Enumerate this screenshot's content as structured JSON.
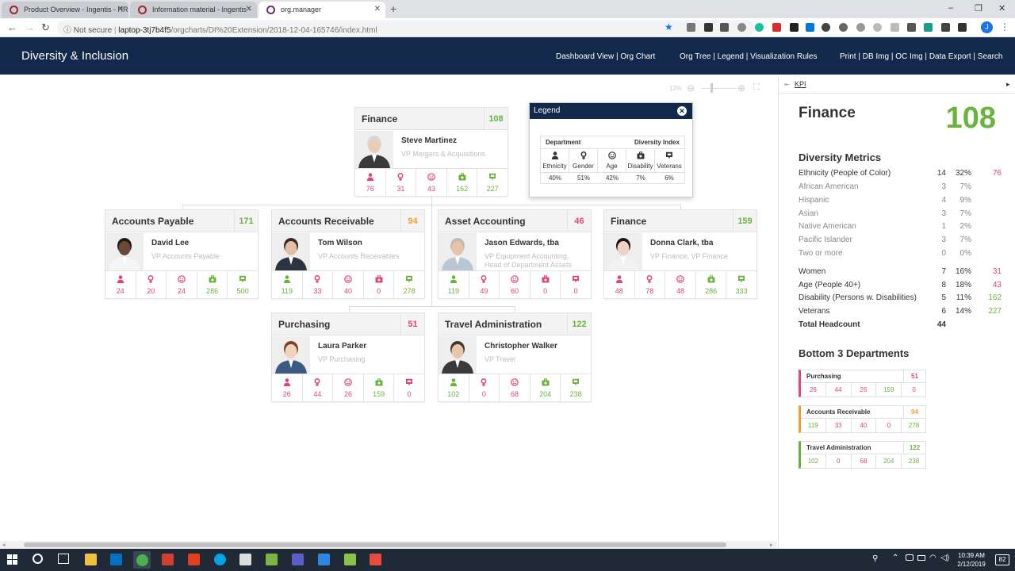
{
  "browser": {
    "tabs": [
      {
        "title": "Product Overview - Ingentis - HR"
      },
      {
        "title": "Information material - Ingentis - "
      },
      {
        "title": "org.manager"
      }
    ],
    "window_controls": [
      "–",
      "❐",
      "✕"
    ],
    "security": "Not secure",
    "url_host": "laptop-3tj7b4f5",
    "url_path": "/orgcharts/DI%20Extension/2018-12-04-165746/index.html",
    "avatar": "J"
  },
  "header": {
    "title": "Diversity & Inclusion",
    "nav1": "Dashboard View | Org Chart",
    "nav2": "Org Tree | Legend | Visualization Rules",
    "nav3": "Print | DB Img | OC Img | Data Export | Search"
  },
  "zoom": {
    "level": "12%"
  },
  "metric_icons": [
    "person-icon",
    "gender-icon",
    "age-icon",
    "disability-icon",
    "veterans-icon"
  ],
  "cards": [
    {
      "id": "finance-root",
      "name": "Finance",
      "count": "108",
      "count_color": "#6ab43e",
      "person": "Steve Martinez",
      "role": "VP Mergers & Acquisitions",
      "metrics": [
        {
          "v": "76",
          "c": "pink"
        },
        {
          "v": "31",
          "c": "pink"
        },
        {
          "v": "43",
          "c": "pink"
        },
        {
          "v": "162",
          "c": "green"
        },
        {
          "v": "227",
          "c": "green"
        }
      ]
    },
    {
      "id": "accounts-payable",
      "name": "Accounts Payable",
      "count": "171",
      "count_color": "#6ab43e",
      "person": "David Lee",
      "role": "VP Accounts Payable",
      "metrics": [
        {
          "v": "24",
          "c": "pink"
        },
        {
          "v": "20",
          "c": "pink"
        },
        {
          "v": "24",
          "c": "pink"
        },
        {
          "v": "286",
          "c": "green"
        },
        {
          "v": "500",
          "c": "green"
        }
      ]
    },
    {
      "id": "accounts-receivable",
      "name": "Accounts Receivable",
      "count": "94",
      "count_color": "#f0a030",
      "person": "Tom Wilson",
      "role": "VP Accounts Receivables",
      "metrics": [
        {
          "v": "119",
          "c": "green"
        },
        {
          "v": "33",
          "c": "pink"
        },
        {
          "v": "40",
          "c": "pink"
        },
        {
          "v": "0",
          "c": "pink"
        },
        {
          "v": "278",
          "c": "green"
        }
      ]
    },
    {
      "id": "asset-accounting",
      "name": "Asset Accounting",
      "count": "46",
      "count_color": "#e0447a",
      "person": "Jason Edwards, tba",
      "role": "VP Equipment Accounting, Head of Department Assets",
      "metrics": [
        {
          "v": "119",
          "c": "green"
        },
        {
          "v": "49",
          "c": "pink"
        },
        {
          "v": "60",
          "c": "pink"
        },
        {
          "v": "0",
          "c": "pink"
        },
        {
          "v": "0",
          "c": "pink"
        }
      ]
    },
    {
      "id": "finance-sub",
      "name": "Finance",
      "count": "159",
      "count_color": "#6ab43e",
      "person": "Donna Clark, tba",
      "role": "VP Finance, VP Finance",
      "metrics": [
        {
          "v": "48",
          "c": "pink"
        },
        {
          "v": "78",
          "c": "pink"
        },
        {
          "v": "48",
          "c": "pink"
        },
        {
          "v": "286",
          "c": "green"
        },
        {
          "v": "333",
          "c": "green"
        }
      ]
    },
    {
      "id": "purchasing",
      "name": "Purchasing",
      "count": "51",
      "count_color": "#e0447a",
      "person": "Laura Parker",
      "role": "VP Purchasing",
      "metrics": [
        {
          "v": "26",
          "c": "pink"
        },
        {
          "v": "44",
          "c": "pink"
        },
        {
          "v": "26",
          "c": "pink"
        },
        {
          "v": "159",
          "c": "green"
        },
        {
          "v": "0",
          "c": "pink"
        }
      ]
    },
    {
      "id": "travel-administration",
      "name": "Travel Administration",
      "count": "122",
      "count_color": "#6ab43e",
      "person": "Christopher Walker",
      "role": "VP Travel",
      "metrics": [
        {
          "v": "102",
          "c": "green"
        },
        {
          "v": "0",
          "c": "pink"
        },
        {
          "v": "68",
          "c": "pink"
        },
        {
          "v": "204",
          "c": "green"
        },
        {
          "v": "238",
          "c": "green"
        }
      ]
    }
  ],
  "legend": {
    "title": "Legend",
    "department": "Department",
    "diversity_index": "Diversity Index",
    "items": [
      {
        "label": "Ethnicity",
        "value": "40%"
      },
      {
        "label": "Gender",
        "value": "51%"
      },
      {
        "label": "Age",
        "value": "42%"
      },
      {
        "label": "Disability",
        "value": "7%"
      },
      {
        "label": "Veterans",
        "value": "6%"
      }
    ]
  },
  "kpi": {
    "tab": "KPI",
    "title": "Finance",
    "count": "108",
    "metrics_title": "Diversity Metrics",
    "rows": [
      {
        "label": "Ethnicity (People of Color)",
        "v1": "14",
        "v2": "32%",
        "v3": "76",
        "v3c": "#e0447a",
        "dark": true
      },
      {
        "label": "African American",
        "v1": "3",
        "v2": "7%",
        "v3": "",
        "v3c": "",
        "dark": false
      },
      {
        "label": "Hispanic",
        "v1": "4",
        "v2": "9%",
        "v3": "",
        "v3c": "",
        "dark": false
      },
      {
        "label": "Asian",
        "v1": "3",
        "v2": "7%",
        "v3": "",
        "v3c": "",
        "dark": false
      },
      {
        "label": "Native American",
        "v1": "1",
        "v2": "2%",
        "v3": "",
        "v3c": "",
        "dark": false
      },
      {
        "label": "Pacific Islander",
        "v1": "3",
        "v2": "7%",
        "v3": "",
        "v3c": "",
        "dark": false
      },
      {
        "label": "Two or more",
        "v1": "0",
        "v2": "0%",
        "v3": "",
        "v3c": "",
        "dark": false
      },
      {
        "label": "Women",
        "v1": "7",
        "v2": "16%",
        "v3": "31",
        "v3c": "#e0447a",
        "dark": true
      },
      {
        "label": "Age (People 40+)",
        "v1": "8",
        "v2": "18%",
        "v3": "43",
        "v3c": "#e0447a",
        "dark": true
      },
      {
        "label": "Disability (Persons w. Disabilities)",
        "v1": "5",
        "v2": "11%",
        "v3": "162",
        "v3c": "#6ab43e",
        "dark": true
      },
      {
        "label": "Veterans",
        "v1": "6",
        "v2": "14%",
        "v3": "227",
        "v3c": "#6ab43e",
        "dark": true
      },
      {
        "label": "Total Headcount",
        "v1": "44",
        "v2": "",
        "v3": "",
        "v3c": "",
        "dark": true,
        "bold": true
      }
    ],
    "bottom_title": "Bottom 3 Departments",
    "bottom": [
      {
        "name": "Purchasing",
        "count": "51",
        "color": "#e0447a",
        "metrics": [
          {
            "v": "26",
            "c": "pink"
          },
          {
            "v": "44",
            "c": "pink"
          },
          {
            "v": "26",
            "c": "pink"
          },
          {
            "v": "159",
            "c": "green"
          },
          {
            "v": "0",
            "c": "pink"
          }
        ]
      },
      {
        "name": "Accounts Receivable",
        "count": "94",
        "color": "#f0a030",
        "metrics": [
          {
            "v": "119",
            "c": "green"
          },
          {
            "v": "33",
            "c": "pink"
          },
          {
            "v": "40",
            "c": "pink"
          },
          {
            "v": "0",
            "c": "pink"
          },
          {
            "v": "278",
            "c": "green"
          }
        ]
      },
      {
        "name": "Travel Administration",
        "count": "122",
        "color": "#6ab43e",
        "metrics": [
          {
            "v": "102",
            "c": "green"
          },
          {
            "v": "0",
            "c": "pink"
          },
          {
            "v": "68",
            "c": "pink"
          },
          {
            "v": "204",
            "c": "green"
          },
          {
            "v": "238",
            "c": "green"
          }
        ]
      }
    ]
  },
  "taskbar": {
    "time": "10:39 AM",
    "date": "2/12/2019",
    "notifications": "82"
  }
}
